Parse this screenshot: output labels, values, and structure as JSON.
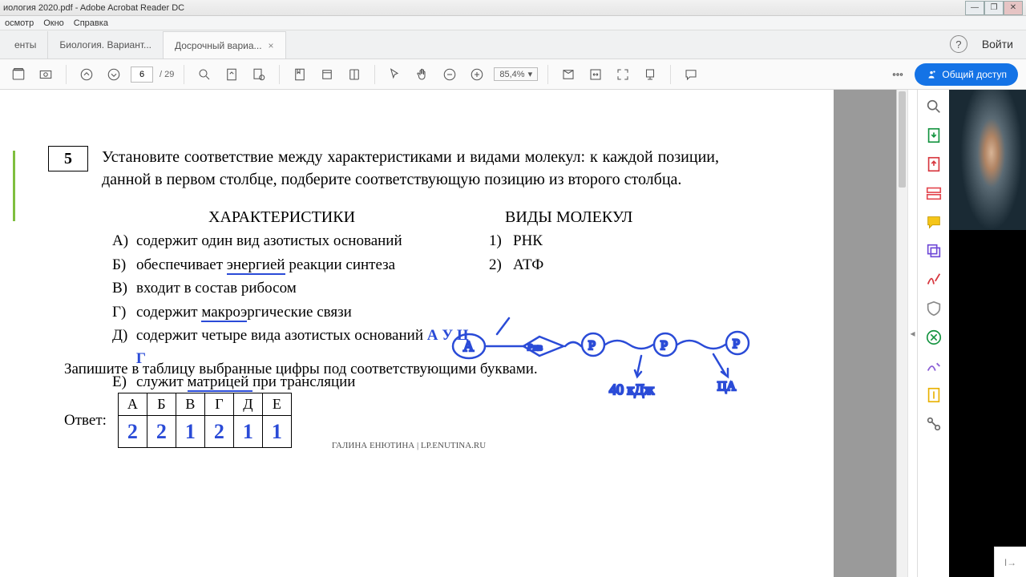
{
  "window": {
    "title": "иология 2020.pdf - Adobe Acrobat Reader DC"
  },
  "menu": {
    "view": "осмотр",
    "window": "Окно",
    "help": "Справка"
  },
  "tabs": {
    "left": "енты",
    "items": [
      {
        "label": "Биология. Вариант..."
      },
      {
        "label": "Досрочный вариа...",
        "active": true
      }
    ]
  },
  "tabright": {
    "login": "Войти"
  },
  "toolbar": {
    "page_current": "6",
    "page_total": "/ 29",
    "zoom": "85,4%",
    "share": "Общий доступ"
  },
  "doc": {
    "qnum": "5",
    "question": "Установите соответствие между характеристиками и видами молекул: к каждой позиции, данной в первом столбце, подберите соответствующую позицию из второго столбца.",
    "headA": "ХАРАКТЕРИСТИКИ",
    "headB": "ВИДЫ МОЛЕКУЛ",
    "A": [
      {
        "m": "А)",
        "t": "содержит один вид азотистых оснований"
      },
      {
        "m": "Б)",
        "t_pre": "обеспечивает ",
        "u": "энергией",
        "t_post": " реакции синтеза"
      },
      {
        "m": "В)",
        "t": "входит в состав рибосом"
      },
      {
        "m": "Г)",
        "t_pre": "содержит ",
        "u": "макроэ",
        "t_post": "ргические связи"
      },
      {
        "m": "Д)",
        "t": "содержит четыре вида азотистых оснований",
        "hw": "  А У Ц Г"
      },
      {
        "m": "Е)",
        "t_pre": "служит ",
        "u": "матрицей ",
        "t_post": "при трансляции"
      }
    ],
    "B": [
      {
        "m": "1)",
        "t": "РНК"
      },
      {
        "m": "2)",
        "t": "АТФ"
      }
    ],
    "instr": "Запишите в таблицу выбранные цифры под соответствующими буквами.",
    "answer_label": "Ответ:",
    "table_head": [
      "А",
      "Б",
      "В",
      "Г",
      "Д",
      "Е"
    ],
    "table_vals": [
      "2",
      "2",
      "1",
      "2",
      "1",
      "1"
    ],
    "footer": "ГАЛИНА ЕНЮТИНА  |  LP.ENUTINA.RU"
  }
}
